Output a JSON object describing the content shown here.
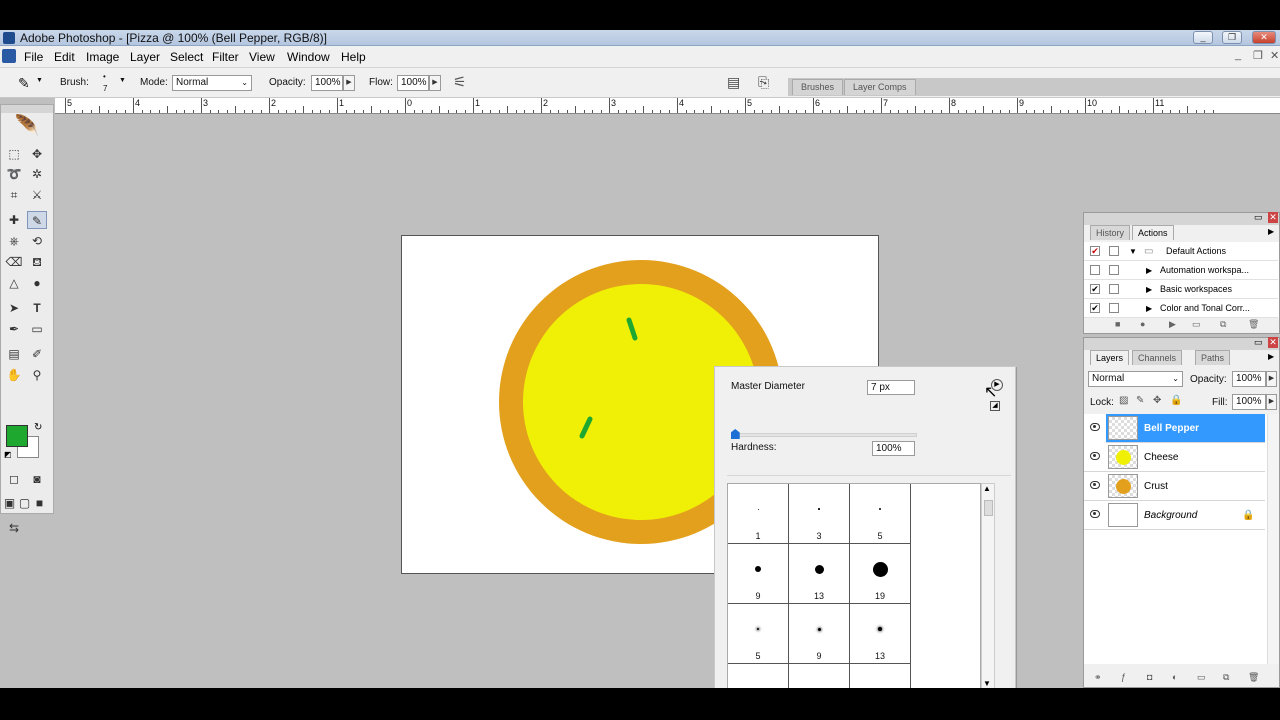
{
  "titlebar": {
    "title": "Adobe Photoshop - [Pizza @ 100% (Bell Pepper, RGB/8)]"
  },
  "menu": {
    "items": [
      "File",
      "Edit",
      "Image",
      "Layer",
      "Select",
      "Filter",
      "View",
      "Window",
      "Help"
    ]
  },
  "options": {
    "brush_label": "Brush:",
    "brush_size": "7",
    "mode_label": "Mode:",
    "mode_value": "Normal",
    "opacity_label": "Opacity:",
    "opacity_value": "100%",
    "flow_label": "Flow:",
    "flow_value": "100%"
  },
  "dock_tabs": [
    "Brushes",
    "Layer Comps"
  ],
  "ruler": {
    "labels": [
      "5",
      "4",
      "3",
      "2",
      "1",
      "0",
      "1",
      "2",
      "3",
      "4",
      "5",
      "6",
      "7",
      "8",
      "9",
      "10",
      "11"
    ]
  },
  "colors": {
    "foreground": "#1fa82f",
    "background": "#ffffff",
    "crust": "#e3a01c",
    "cheese": "#f0f007",
    "pepper": "#1fa82f",
    "selection": "#3399ff"
  },
  "brush_popup": {
    "master_label": "Master Diameter",
    "master_value": "7 px",
    "master_fraction": 0.02,
    "hardness_label": "Hardness:",
    "hardness_value": "100%",
    "hardness_fraction": 1.0,
    "presets": [
      {
        "label": "1",
        "size": 1,
        "soft": false
      },
      {
        "label": "3",
        "size": 1.5,
        "soft": false
      },
      {
        "label": "5",
        "size": 2,
        "soft": false
      },
      {
        "label": "9",
        "size": 6,
        "soft": false
      },
      {
        "label": "13",
        "size": 9,
        "soft": false
      },
      {
        "label": "19",
        "size": 15,
        "soft": false
      },
      {
        "label": "5",
        "size": 2,
        "soft": true
      },
      {
        "label": "9",
        "size": 3,
        "soft": true
      },
      {
        "label": "13",
        "size": 4,
        "soft": true
      }
    ]
  },
  "history_panel": {
    "tabs": [
      "History",
      "Actions"
    ],
    "rows": [
      {
        "label": "Default Actions",
        "checked": true,
        "folder": true
      },
      {
        "label": "Automation workspa...",
        "checked": false,
        "folder": false
      },
      {
        "label": "Basic workspaces",
        "checked": true,
        "folder": false
      },
      {
        "label": "Color and Tonal Corr...",
        "checked": true,
        "folder": false
      }
    ]
  },
  "layers_panel": {
    "tabs": [
      "Layers",
      "Channels",
      "Paths"
    ],
    "blend_mode": "Normal",
    "opacity_label": "Opacity:",
    "opacity_value": "100%",
    "lock_label": "Lock:",
    "fill_label": "Fill:",
    "fill_value": "100%",
    "layers": [
      {
        "name": "Bell Pepper",
        "selected": true,
        "thumb": "transparent"
      },
      {
        "name": "Cheese",
        "selected": false,
        "thumb": "cheese"
      },
      {
        "name": "Crust",
        "selected": false,
        "thumb": "crust"
      },
      {
        "name": "Background",
        "selected": false,
        "thumb": "white",
        "locked": true
      }
    ]
  }
}
